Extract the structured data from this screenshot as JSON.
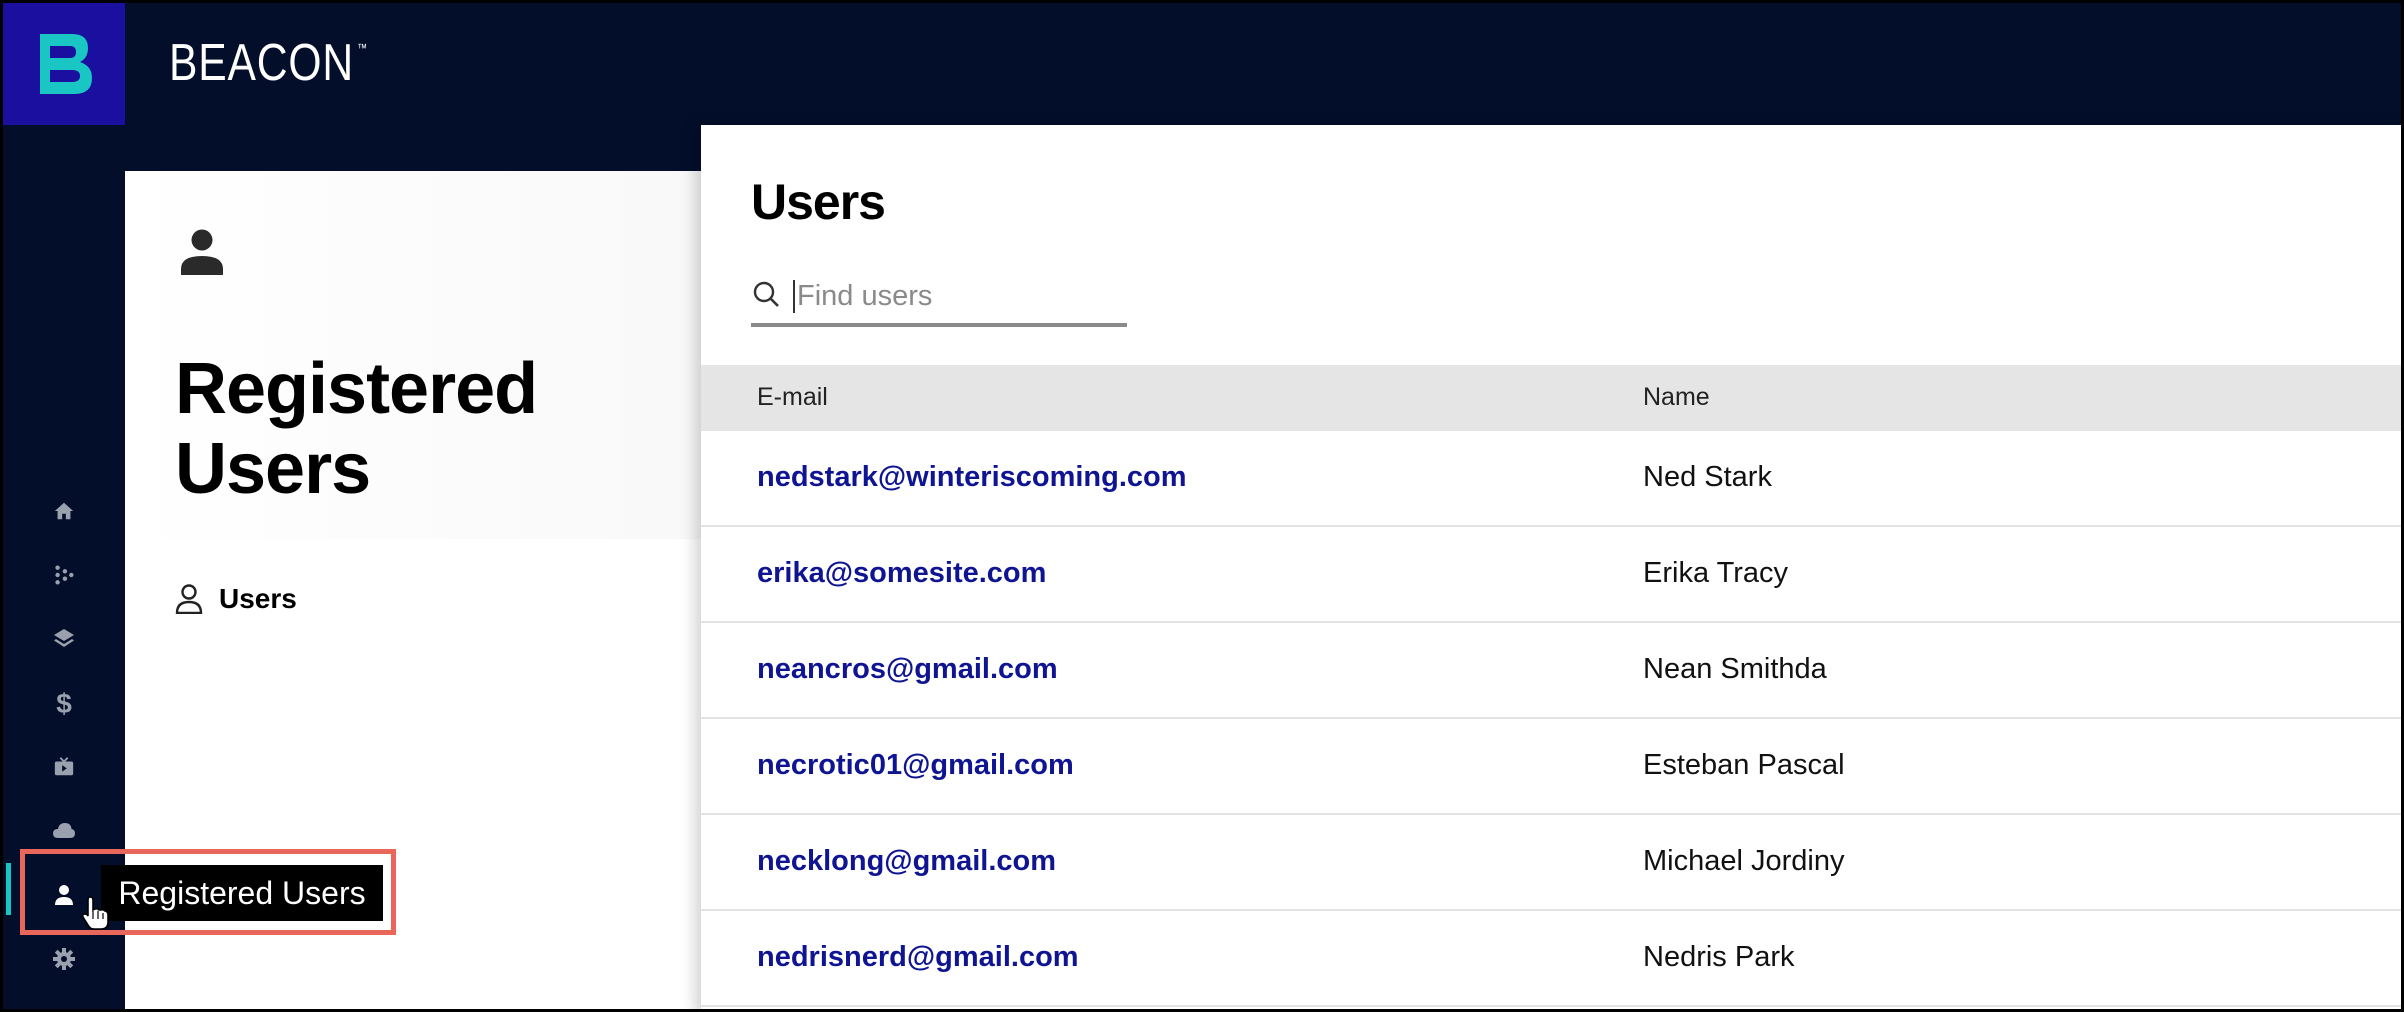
{
  "app": {
    "brand": "BEACON",
    "trademark": "™"
  },
  "rail": {
    "items": [
      {
        "icon": "home-icon"
      },
      {
        "icon": "flow-icon"
      },
      {
        "icon": "layers-icon"
      },
      {
        "icon": "dollar-icon"
      },
      {
        "icon": "tv-icon"
      },
      {
        "icon": "cloud-icon"
      },
      {
        "icon": "user-icon",
        "active": true
      },
      {
        "icon": "gear-icon"
      }
    ],
    "tooltip": "Registered Users"
  },
  "left_panel": {
    "title": "Registered Users",
    "nav_item": "Users"
  },
  "main": {
    "title": "Users",
    "search": {
      "placeholder": "Find users",
      "value": ""
    },
    "columns": [
      "E-mail",
      "Name"
    ],
    "rows": [
      {
        "email": "nedstark@winteriscoming.com",
        "name": "Ned Stark"
      },
      {
        "email": "erika@somesite.com",
        "name": "Erika Tracy"
      },
      {
        "email": "neancros@gmail.com",
        "name": "Nean Smithda"
      },
      {
        "email": "necrotic01@gmail.com",
        "name": "Esteban Pascal"
      },
      {
        "email": "necklong@gmail.com",
        "name": "Michael Jordiny"
      },
      {
        "email": "nedrisnerd@gmail.com",
        "name": "Nedris Park"
      }
    ]
  },
  "colors": {
    "nav_bg": "#030e2a",
    "logo_bg": "#1a0f9e",
    "accent": "#19c6c4",
    "link": "#0f1592",
    "highlight": "#e8675a"
  }
}
